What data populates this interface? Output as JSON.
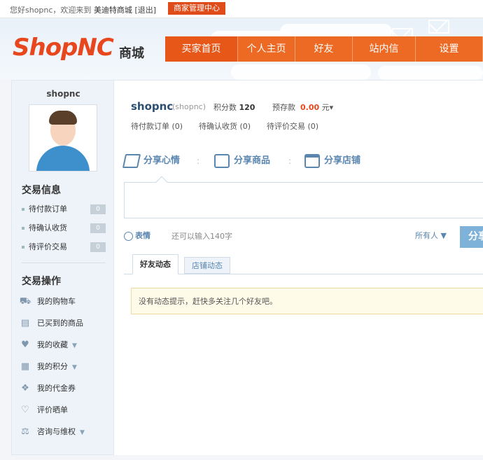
{
  "topbar": {
    "greeting_prefix": "您好shopnc，欢迎来到 ",
    "site_name": "美迪特商城",
    "logout": "[退出]",
    "admin_button": "商家管理中心"
  },
  "header": {
    "logo": "ShopNC",
    "logo_sub": "商城"
  },
  "nav": {
    "items": [
      {
        "label": "买家首页"
      },
      {
        "label": "个人主页"
      },
      {
        "label": "好友"
      },
      {
        "label": "站内信"
      },
      {
        "label": "设置"
      }
    ]
  },
  "sidebar": {
    "username": "shopnc",
    "trade_info_title": "交易信息",
    "trade_info": [
      {
        "label": "待付款订单",
        "count": "0"
      },
      {
        "label": "待确认收货",
        "count": "0"
      },
      {
        "label": "待评价交易",
        "count": "0"
      }
    ],
    "trade_ops_title": "交易操作",
    "trade_ops": [
      {
        "label": "我的购物车",
        "icon": "cart-icon"
      },
      {
        "label": "已买到的商品",
        "icon": "basket-icon"
      },
      {
        "label": "我的收藏",
        "icon": "heart-medal-icon",
        "caret": "▼"
      },
      {
        "label": "我的积分",
        "icon": "calculator-icon",
        "caret": "▼"
      },
      {
        "label": "我的代金券",
        "icon": "gift-icon"
      },
      {
        "label": "评价晒单",
        "icon": "heart-icon"
      },
      {
        "label": "咨询与维权",
        "icon": "scale-icon",
        "caret": "▼"
      }
    ]
  },
  "main": {
    "user_name": "shopnc",
    "user_handle": "(shopnc)",
    "points_label": "积分数",
    "points_value": "120",
    "deposit_label": "预存款",
    "deposit_value": "0.00",
    "deposit_unit": "元▾",
    "pending_pay": "待付款订单 (0)",
    "pending_confirm": "待确认收货 (0)",
    "pending_review": "待评价交易 (0)",
    "share_mood": "分享心情",
    "share_goods": "分享商品",
    "share_store": "分享店铺",
    "emoji_label": "表情",
    "remaining": "还可以输入140字",
    "audience": "所有人 ▼",
    "share_button": "分享",
    "tab_friends": "好友动态",
    "tab_stores": "店铺动态",
    "notice": "没有动态提示，赶快多关注几个好友吧。"
  },
  "colors": {
    "brand": "#e8461c",
    "nav": "#ec6a23",
    "link": "#5a86b0"
  }
}
